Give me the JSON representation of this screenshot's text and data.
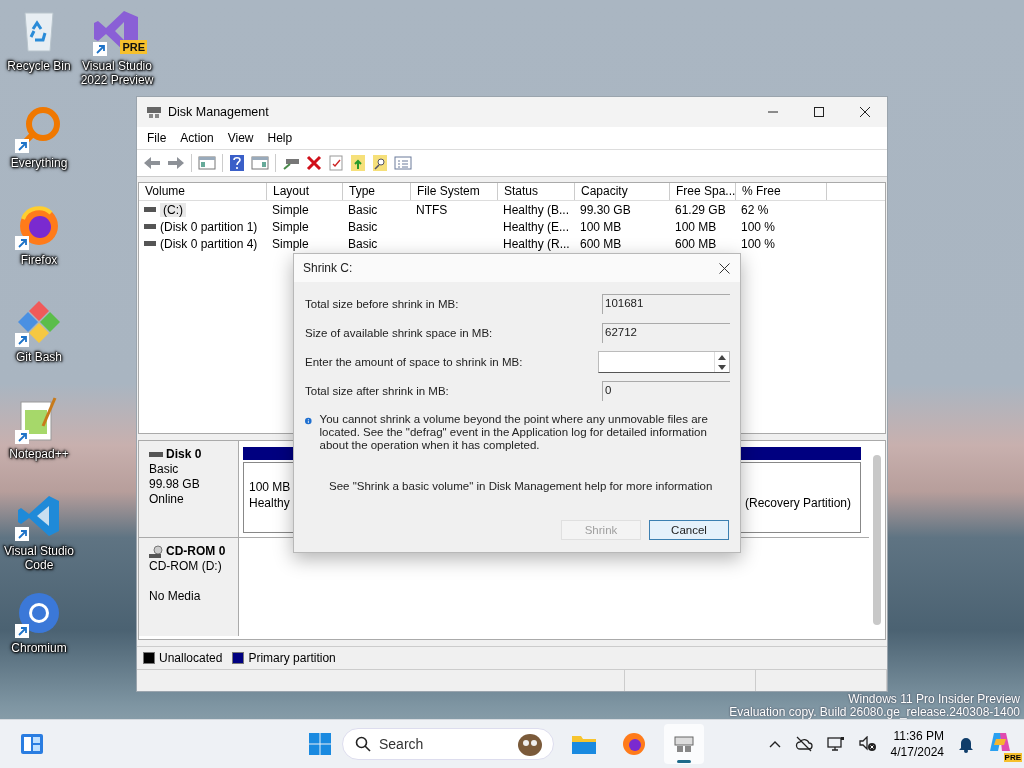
{
  "desktop_icons": [
    {
      "kind": "recycle",
      "label": "Recycle Bin",
      "shortcut": false
    },
    {
      "kind": "vs",
      "label": "Visual Studio 2022 Preview",
      "badge": "PRE",
      "shortcut": true
    },
    {
      "kind": "everything",
      "label": "Everything",
      "shortcut": true
    },
    {
      "kind": "firefox",
      "label": "Firefox",
      "shortcut": true
    },
    {
      "kind": "gitbash",
      "label": "Git Bash",
      "shortcut": true
    },
    {
      "kind": "notepad",
      "label": "Notepad++",
      "shortcut": true
    },
    {
      "kind": "vscode",
      "label": "Visual Studio Code",
      "shortcut": true
    },
    {
      "kind": "chromium",
      "label": "Chromium",
      "shortcut": true
    }
  ],
  "window": {
    "title": "Disk Management",
    "menu": [
      "File",
      "Action",
      "View",
      "Help"
    ],
    "volumes": {
      "columns": [
        "Volume",
        "Layout",
        "Type",
        "File System",
        "Status",
        "Capacity",
        "Free Spa...",
        "% Free"
      ],
      "rows": [
        [
          "(C:)",
          "Simple",
          "Basic",
          "NTFS",
          "Healthy (B...",
          "99.30 GB",
          "61.29 GB",
          "62 %"
        ],
        [
          "(Disk 0 partition 1)",
          "Simple",
          "Basic",
          "",
          "Healthy (E...",
          "100 MB",
          "100 MB",
          "100 %"
        ],
        [
          "(Disk 0 partition 4)",
          "Simple",
          "Basic",
          "",
          "Healthy (R...",
          "600 MB",
          "600 MB",
          "100 %"
        ]
      ]
    },
    "disks": [
      {
        "kind": "disk",
        "name": "Disk 0",
        "details": [
          "Basic",
          "99.98 GB",
          "Online"
        ],
        "partitions": [
          {
            "lines": [
              "100 MB",
              "Healthy"
            ]
          },
          {
            "lines": [
              "(Recovery Partition)"
            ]
          }
        ]
      },
      {
        "kind": "cdrom",
        "name": "CD-ROM 0",
        "details": [
          "CD-ROM (D:)"
        ],
        "media": "No Media"
      }
    ],
    "legend": [
      {
        "label": "Unallocated",
        "color": "#000000"
      },
      {
        "label": "Primary partition",
        "color": "#000080"
      }
    ]
  },
  "dialog": {
    "title": "Shrink C:",
    "fields": [
      {
        "kind": "readonly",
        "label": "Total size before shrink in MB:",
        "value": "101681"
      },
      {
        "kind": "readonly",
        "label": "Size of available shrink space in MB:",
        "value": "62712"
      },
      {
        "kind": "spin",
        "label": "Enter the amount of space to shrink in MB:"
      },
      {
        "kind": "readonly",
        "label": "Total size after shrink in MB:",
        "value": "0"
      }
    ],
    "info": "You cannot shrink a volume beyond the point where any unmovable files are located. See the \"defrag\" event in the Application log for detailed information about the operation when it has completed.",
    "help": "See \"Shrink a basic volume\" in Disk Management help for more information",
    "buttons": [
      {
        "label": "Shrink",
        "disabled": true,
        "focused": false
      },
      {
        "label": "Cancel",
        "disabled": false,
        "focused": true
      }
    ]
  },
  "watermark": [
    "Windows 11 Pro Insider Preview",
    "Evaluation copy. Build 26080.ge_release.240308-1400"
  ],
  "taskbar": {
    "search": {
      "placeholder": "Search"
    },
    "apps": [
      {
        "kind": "explorer",
        "active": false
      },
      {
        "kind": "firefox",
        "active": false
      },
      {
        "kind": "diskmgmt",
        "active": true
      }
    ],
    "time": "11:36 PM",
    "date": "4/17/2024",
    "copilot_badge": "PRE"
  }
}
